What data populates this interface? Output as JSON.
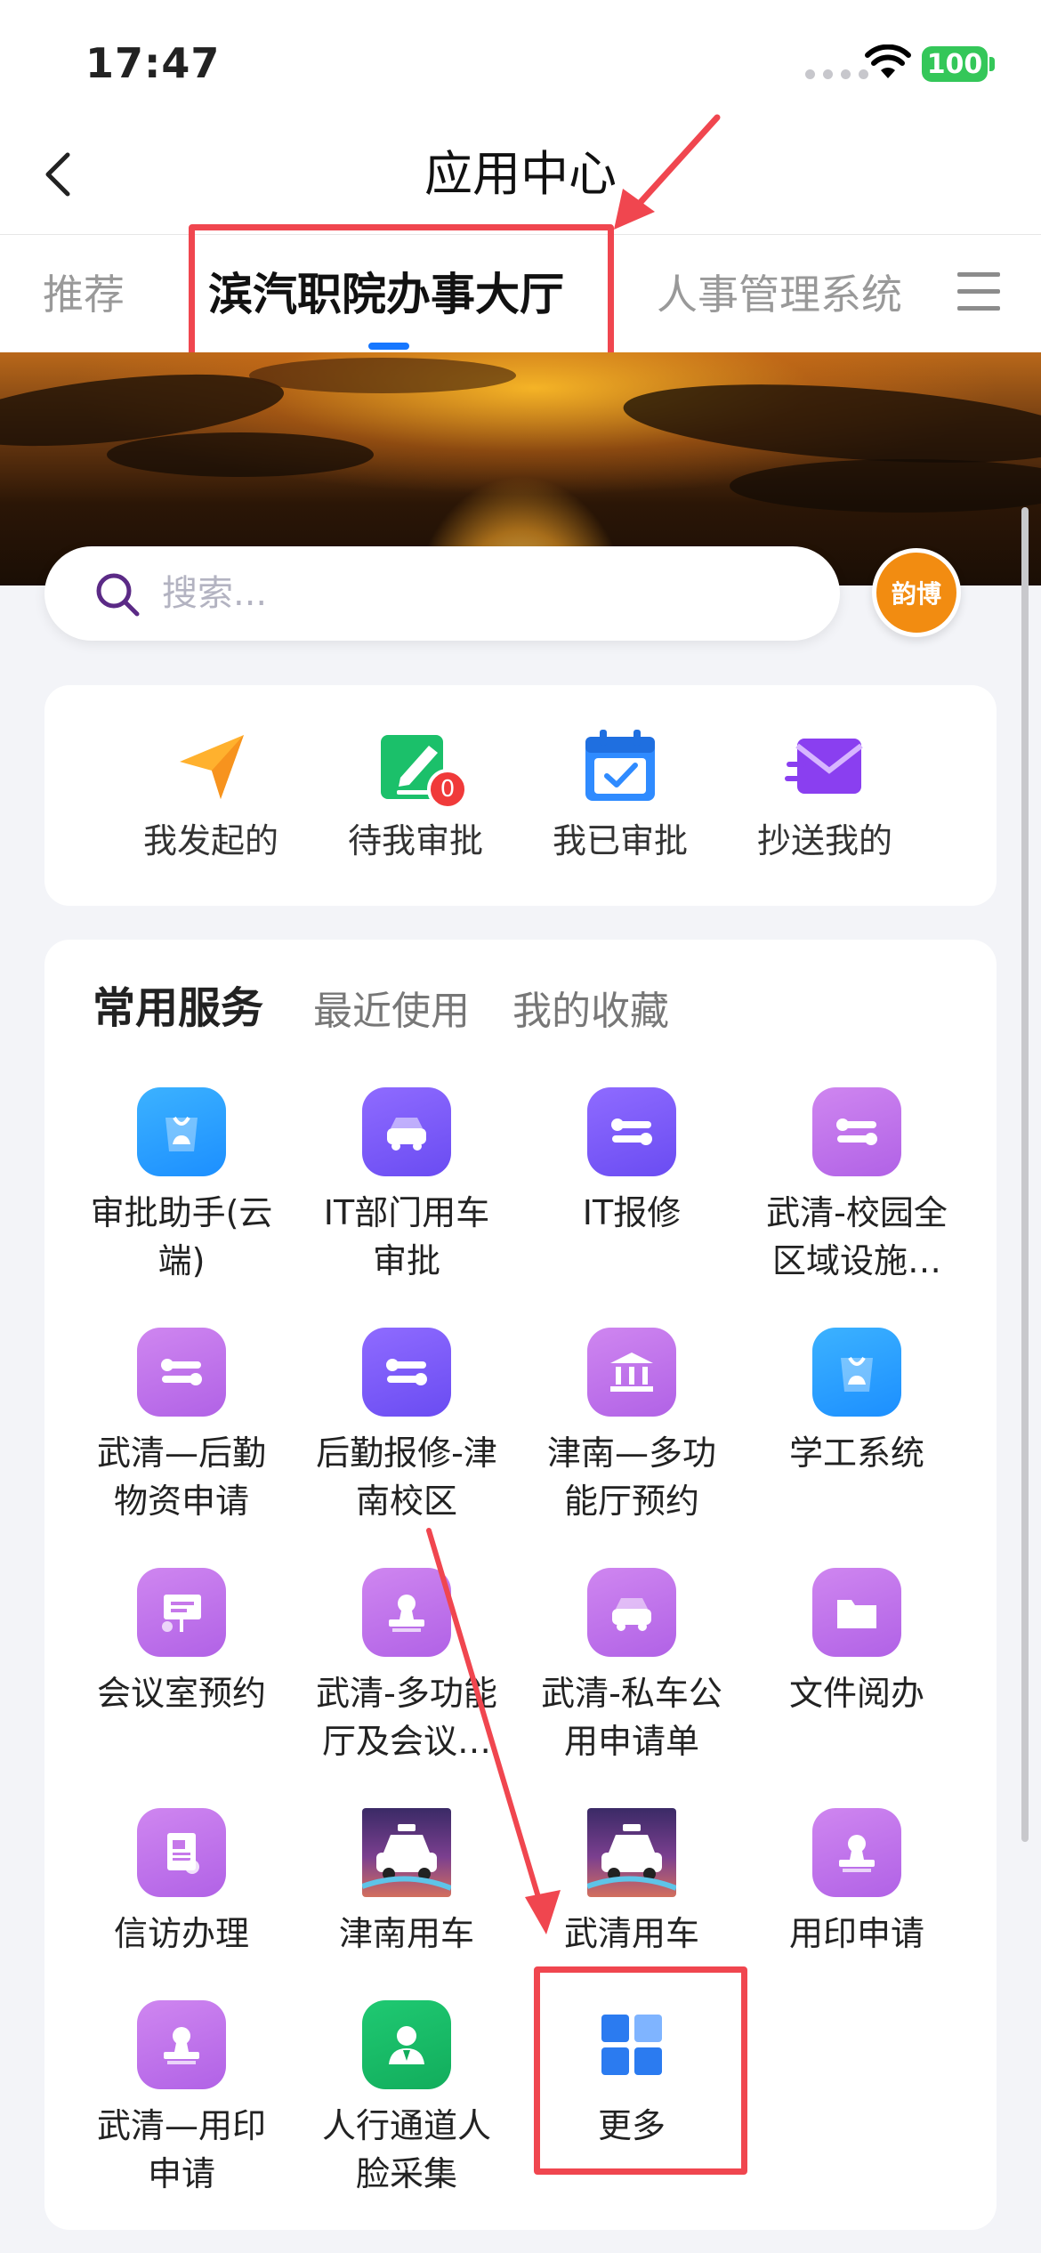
{
  "status_bar": {
    "time": "17:47",
    "battery": "100"
  },
  "nav": {
    "title": "应用中心"
  },
  "tabs": [
    {
      "label": "推荐"
    },
    {
      "label": "滨汽职院办事大厅"
    },
    {
      "label": "人事管理系统"
    }
  ],
  "search": {
    "placeholder": "搜索..."
  },
  "avatar": {
    "label": "韵博"
  },
  "approvals": [
    {
      "label": "我发起的",
      "icon": "send-icon"
    },
    {
      "label": "待我审批",
      "icon": "edit-icon",
      "badge": "0"
    },
    {
      "label": "我已审批",
      "icon": "calendar-check-icon"
    },
    {
      "label": "抄送我的",
      "icon": "mail-icon"
    }
  ],
  "service_tabs": [
    {
      "label": "常用服务"
    },
    {
      "label": "最近使用"
    },
    {
      "label": "我的收藏"
    }
  ],
  "apps": [
    {
      "label": "审批助手(云端)",
      "icon": "bag-icon"
    },
    {
      "label": "IT部门用车审批",
      "icon": "car-icon"
    },
    {
      "label": "IT报修",
      "icon": "wrench-icon"
    },
    {
      "label": "武清-校园全区域设施…",
      "icon": "wrench-icon"
    },
    {
      "label": "武清—后勤物资申请",
      "icon": "wrench-icon"
    },
    {
      "label": "后勤报修-津南校区",
      "icon": "wrench-icon"
    },
    {
      "label": "津南—多功能厅预约",
      "icon": "bank-icon"
    },
    {
      "label": "学工系统",
      "icon": "bag-icon"
    },
    {
      "label": "会议室预约",
      "icon": "presentation-icon"
    },
    {
      "label": "武清-多功能厅及会议…",
      "icon": "stamp-icon"
    },
    {
      "label": "武清-私车公用申请单",
      "icon": "car-icon"
    },
    {
      "label": "文件阅办",
      "icon": "folder-icon"
    },
    {
      "label": "信访办理",
      "icon": "document-icon"
    },
    {
      "label": "津南用车",
      "icon": "taxi-icon"
    },
    {
      "label": "武清用车",
      "icon": "taxi-icon"
    },
    {
      "label": "用印申请",
      "icon": "stamp-icon"
    },
    {
      "label": "武清—用印申请",
      "icon": "stamp-icon"
    },
    {
      "label": "人行通道人脸采集",
      "icon": "person-icon"
    },
    {
      "label": "更多",
      "icon": "grid-icon"
    }
  ],
  "colors": {
    "accent": "#1677ff",
    "annotation": "#f0464f",
    "avatar": "#f28c11",
    "badge": "#f03a3a"
  }
}
